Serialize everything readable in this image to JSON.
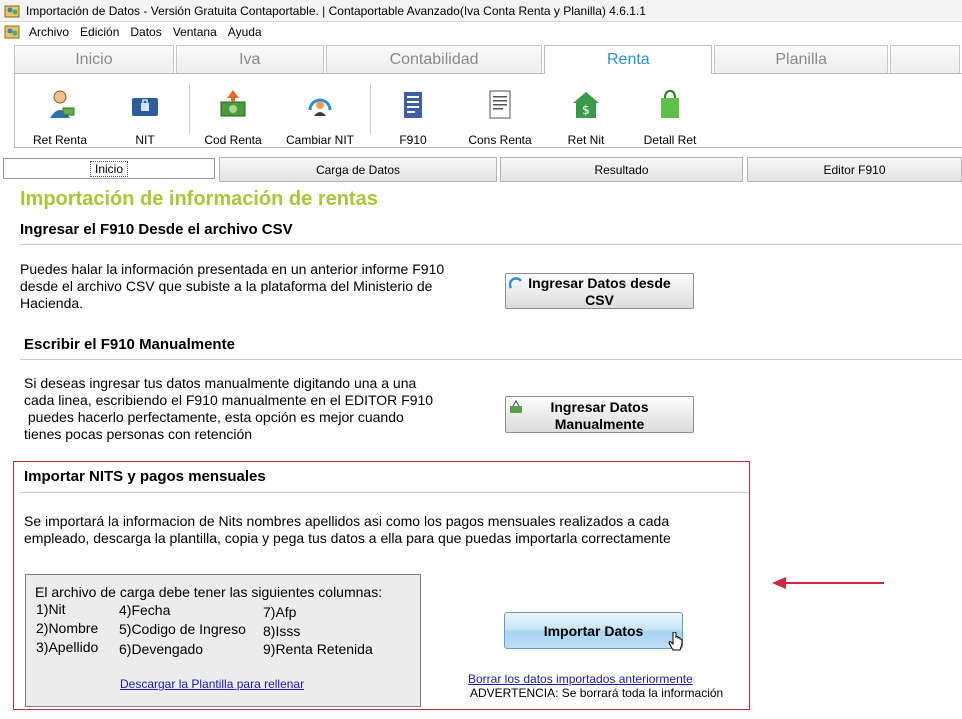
{
  "window": {
    "title": "Importación de Datos - Versión Gratuita Contaportable. | Contaportable Avanzado(Iva Conta Renta y Planilla) 4.6.1.1"
  },
  "menu": {
    "items": [
      "Archivo",
      "Edición",
      "Datos",
      "Ventana",
      "Ayuda"
    ]
  },
  "ribbon": {
    "tabs": [
      "Inicio",
      "Iva",
      "Contabilidad",
      "Renta",
      "Planilla"
    ],
    "active_tab": "Renta",
    "buttons": [
      "Ret Renta",
      "NIT",
      "Cod Renta",
      "Cambiar NIT",
      "F910",
      "Cons Renta",
      "Ret Nit",
      "Detall Ret"
    ]
  },
  "subtabs": [
    "Inicio",
    "Carga de Datos",
    "Resultado",
    "Editor F910"
  ],
  "main": {
    "title": "Importación  de información de rentas",
    "sections": [
      {
        "heading": "Ingresar el F910 Desde el archivo CSV",
        "text_lines": [
          "Puedes halar  la información presentada en un anterior informe F910",
          "desde el archivo CSV que subiste a la plataforma del Ministerio de",
          "Hacienda."
        ],
        "button_lines": [
          "Ingresar Datos desde",
          "CSV"
        ]
      },
      {
        "heading": "Escribir  el F910 Manualmente",
        "text_lines": [
          "Si deseas ingresar tus datos manualmente digitando una a una",
          "cada linea, escribiendo el F910  manualmente en el EDITOR F910",
          " puedes hacerlo perfectamente, esta opción es mejor cuando",
          "tienes pocas personas con retención"
        ],
        "button_lines": [
          "Ingresar Datos",
          "Manualmente"
        ]
      },
      {
        "heading": "Importar NITS y pagos mensuales",
        "text_lines": [
          "Se importará la informacion de Nits nombres apellidos  asi como los pagos mensuales realizados a cada",
          "empleado, descarga la plantilla, copia y pega tus datos a ella para que puedas importarla correctamente"
        ]
      }
    ],
    "columns_box": {
      "title": "El archivo de carga debe tener las siguientes columnas:",
      "columns": [
        "1)Nit",
        "2)Nombre",
        "3)Apellido",
        "4)Fecha",
        "5)Codigo de Ingreso",
        "6)Devengado",
        "7)Afp",
        "8)Isss",
        "9)Renta Retenida"
      ],
      "template_link": "Descargar la Plantilla para rellenar"
    },
    "import_button": "Importar Datos",
    "delete_link": "Borrar los datos importados anteriormente",
    "warning": "ADVERTENCIA: Se borrará toda la información"
  },
  "colors": {
    "accent_green": "#a8c63a",
    "active_tab_blue": "#2b8fd4",
    "highlight_red": "#d0283a",
    "link_blue": "#1a1ab0"
  }
}
